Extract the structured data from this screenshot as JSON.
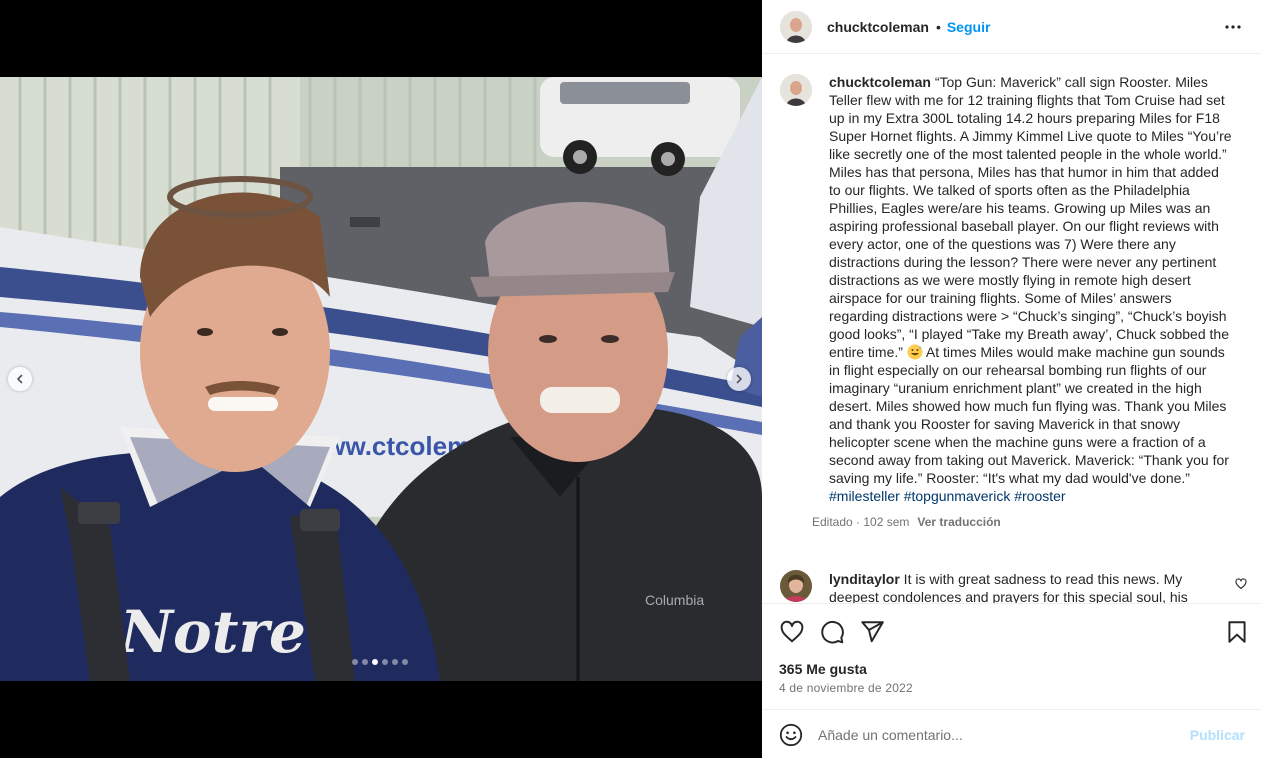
{
  "post": {
    "username": "chucktcoleman",
    "separator": "•",
    "follow_label": "Seguir",
    "more_icon": "more-options-icon"
  },
  "caption": {
    "username": "chucktcoleman",
    "text_1": " “Top Gun: Maverick” call sign Rooster. Miles Teller flew with me for 12 training flights that Tom Cruise had set up in my Extra 300L totaling 14.2 hours preparing Miles for F18 Super Hornet flights. A Jimmy Kimmel Live quote to Miles “You’re like secretly one of the most talented people in the whole world.” Miles has that persona, Miles has that humor in him that added to our flights. We talked of sports often as the Philadelphia Phillies, Eagles were/are his teams. Growing up Miles was an aspiring professional baseball player. On our flight reviews with every actor, one of the questions was 7) Were there any distractions during the lesson? There were never any pertinent distractions as we were mostly flying in remote high desert airspace for our training flights. Some of Miles’ answers regarding distractions were > “Chuck’s singing”, “Chuck’s boyish good looks”, “I played “Take my Breath away’, Chuck sobbed the entire time.” ",
    "emoji": "grinning-sweat-emoji",
    "text_2": " At times Miles would make machine gun sounds in flight especially on our rehearsal bombing run flights of our imaginary “uranium enrichment plant” we created in the high desert. Miles showed how much fun flying was. Thank you Miles and thank you Rooster for saving Maverick in that snowy helicopter scene when the machine guns were a fraction of a second away from taking out Maverick. Maverick: “Thank you for saving my life.” Rooster: “It's what my dad would've done.” ",
    "hashtags": [
      "#milesteller",
      "#topgunmaverick",
      "#rooster"
    ],
    "edited_label": "Editado · 102 sem",
    "translate_label": "Ver traducción"
  },
  "comments": [
    {
      "username": "lyndi­taylor",
      "text": " It is with great sadness to read this news. My deepest condolences and prayers for this special soul, his"
    }
  ],
  "actions": {
    "like_icon": "heart-icon",
    "comment_icon": "comment-icon",
    "share_icon": "share-icon",
    "save_icon": "bookmark-icon",
    "likes_label": "365 Me gusta",
    "date": "4 de noviembre de 2022"
  },
  "add_comment": {
    "emoji_icon": "emoji-icon",
    "placeholder": "Añade un comentario...",
    "publish_label": "Publicar"
  },
  "carousel": {
    "slide_count": 6,
    "active_slide": 3,
    "prev_icon": "chevron-left-icon",
    "next_icon": "chevron-right-icon"
  },
  "photo": {
    "plane_text": "www.ctcolem",
    "jacket_text": "Notre",
    "brand_text": "Columbia"
  },
  "colors": {
    "link": "#00376b",
    "follow": "#0095f6",
    "publish_disabled": "#b2dffc",
    "secondary_text": "#737373"
  }
}
